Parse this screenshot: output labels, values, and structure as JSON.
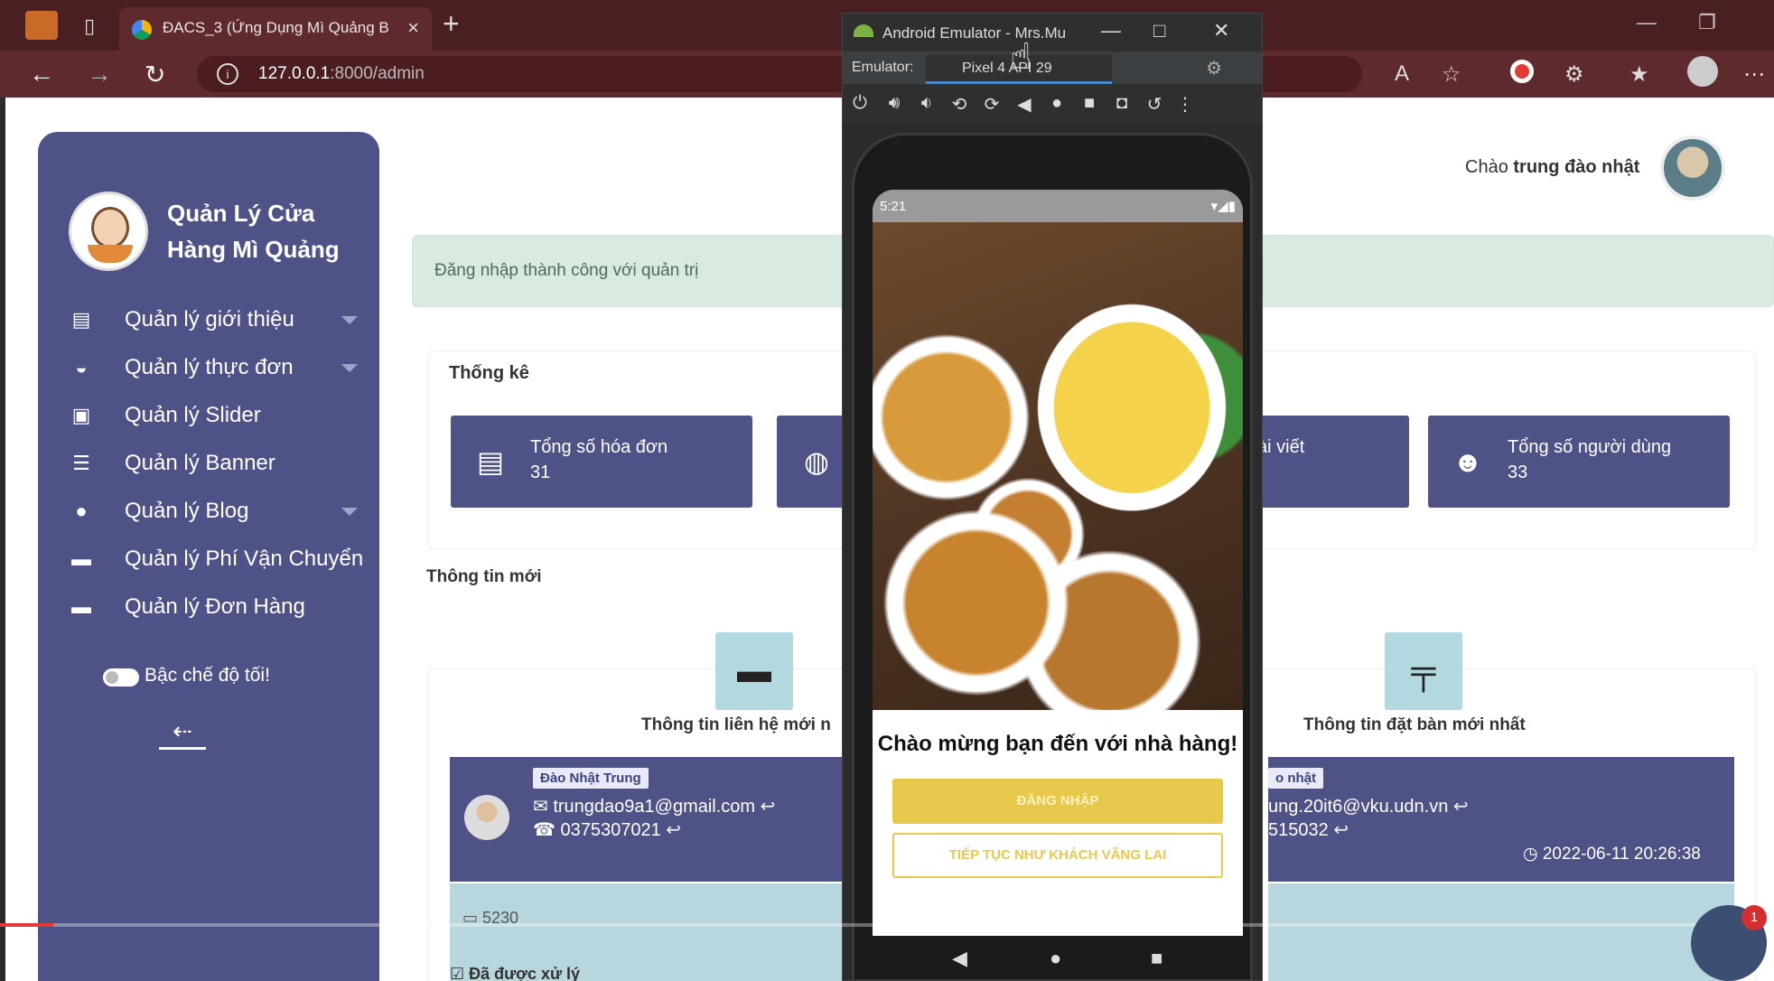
{
  "browser": {
    "tab_title": "ĐACS_3 (Ứng Dụng Mì Quảng B",
    "url_host": "127.0.0.1",
    "url_rest": ":8000/admin",
    "close_glyph": "×",
    "new_tab_glyph": "+"
  },
  "sidebar": {
    "brand": "Quản Lý Cửa Hàng Mì Quảng",
    "items": [
      {
        "label": "Quản lý giới thiệu",
        "icon": "display-icon",
        "glyph": "▤",
        "has_caret": true
      },
      {
        "label": "Quản lý thực đơn",
        "icon": "bowl-icon",
        "glyph": "◒",
        "has_caret": true
      },
      {
        "label": "Quản lý Slider",
        "icon": "slider-icon",
        "glyph": "▣",
        "has_caret": false
      },
      {
        "label": "Quản lý Banner",
        "icon": "banner-icon",
        "glyph": "☰",
        "has_caret": false
      },
      {
        "label": "Quản lý Blog",
        "icon": "blog-icon",
        "glyph": "●",
        "has_caret": true
      },
      {
        "label": "Quản lý Phí Vận Chuyển",
        "icon": "shipping-icon",
        "glyph": "▬",
        "has_caret": false
      },
      {
        "label": "Quản lý Đơn Hàng",
        "icon": "order-icon",
        "glyph": "▬",
        "has_caret": false
      }
    ],
    "dark_mode_label": "Bậc chế độ tối!"
  },
  "header": {
    "greeting_prefix": "Chào ",
    "user_name": "trung đào nhật"
  },
  "alert": {
    "text": "Đăng nhập thành công với quản trị"
  },
  "stats": {
    "title": "Thống kê",
    "cards": [
      {
        "label": "Tổng số hóa đơn",
        "value": "31",
        "icon": "invoice-icon"
      },
      {
        "label": "",
        "value": "",
        "icon": "dish-icon"
      },
      {
        "label": "ài viết",
        "value": "",
        "icon": "post-icon"
      },
      {
        "label": "Tổng số người dùng",
        "value": "33",
        "icon": "users-icon"
      }
    ]
  },
  "new_info": {
    "title": "Thông tin mới",
    "contact": {
      "heading": "Thông tin liên hệ mới n",
      "name": "Đào Nhật Trung",
      "email": "trungdao9a1@gmail.com",
      "phone": "0375307021",
      "message_count": "5230"
    },
    "booking": {
      "heading": "Thông tin đặt bàn mới nhất",
      "name_partial": "o nhật",
      "email_partial": "ung.20it6@vku.udn.vn",
      "phone_partial": "515032",
      "datetime": "2022-06-11 20:26:38"
    },
    "processed_label": "Đã được xử lý"
  },
  "emulator": {
    "window_title": "Android Emulator - Mrs.Mu",
    "tab_label": "Emulator:",
    "device_tab": "Pixel 4 API 29",
    "time": "5:21",
    "welcome": "Chào mừng bạn đến với nhà hàng!",
    "login_button": "ĐĂNG NHẬP",
    "guest_button": "TIẾP TỤC NHƯ KHÁCH VÃNG LAI"
  },
  "video": {
    "progress": 0.03,
    "chat_count": "1"
  },
  "colors": {
    "sidebar": "#4e5286",
    "alert_bg": "#d9ebe0",
    "login_button": "#e8c84a",
    "tab_bar": "#4a1f22"
  }
}
